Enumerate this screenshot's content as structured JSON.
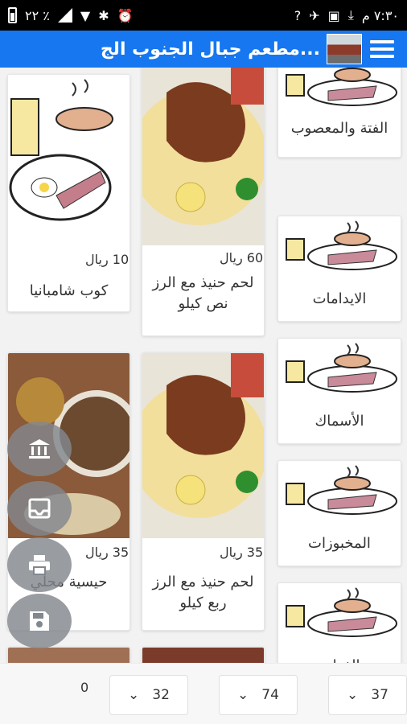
{
  "status_bar": {
    "time": "٧:٣٠ م",
    "battery": "٢٢ ٪",
    "signal_badge": "?"
  },
  "app_bar": {
    "title": "مطعم جبال الجنوب الج...",
    "menu_icon": "hamburger-icon",
    "logo": "restaurant-logo"
  },
  "categories": [
    {
      "label": "الفتة والمعصوب"
    },
    {
      "label": "الايدامات"
    },
    {
      "label": "الأسماك"
    },
    {
      "label": "المخبوزات"
    },
    {
      "label": "الفوا..."
    }
  ],
  "products": [
    {
      "price": "60 ريال",
      "name": "لحم حنيذ مع الرز نص كيلو"
    },
    {
      "price": "10 ريال",
      "name": "كوب شامبانيا"
    },
    {
      "price": "35 ريال",
      "name": "لحم حنيذ مع الرز ربع كيلو"
    },
    {
      "price": "35 ريال",
      "name": "حيسية محلي"
    }
  ],
  "fabs": [
    {
      "icon": "bank-icon"
    },
    {
      "icon": "inbox-icon"
    },
    {
      "icon": "print-icon"
    },
    {
      "icon": "save-icon"
    }
  ],
  "bottom_bar": {
    "counter": "0",
    "pagers": [
      {
        "value": "32"
      },
      {
        "value": "74"
      },
      {
        "value": "37"
      }
    ]
  }
}
